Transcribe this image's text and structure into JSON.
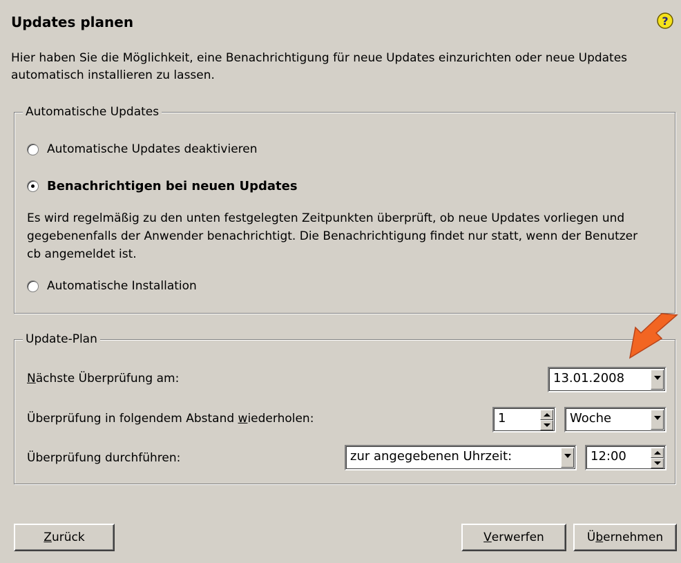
{
  "header": {
    "title": "Updates planen",
    "help_icon": "help-question-icon"
  },
  "intro_text": "Hier haben Sie die Möglichkeit, eine Benachrichtigung für neue Updates einzurichten oder neue Updates automatisch installieren zu lassen.",
  "auto_updates": {
    "legend": "Automatische Updates",
    "options": [
      {
        "label": "Automatische Updates deaktivieren",
        "selected": false
      },
      {
        "label": "Benachrichtigen bei neuen Updates",
        "selected": true
      },
      {
        "label": "Automatische Installation",
        "selected": false
      }
    ],
    "description": "Es wird regelmäßig zu den unten festgelegten Zeitpunkten überprüft, ob neue Updates vorliegen und gegebenenfalls der Anwender benachrichtigt. Die Benachrichtigung findet nur statt, wenn der Benutzer cb angemeldet ist."
  },
  "update_plan": {
    "legend": "Update-Plan",
    "next_check": {
      "label_accel": "N",
      "label_rest": "ächste Überprüfung am:",
      "value": "13.01.2008"
    },
    "repeat": {
      "label_pre": "Überprüfung in folgendem Abstand ",
      "label_accel": "w",
      "label_post": "iederholen:",
      "interval": "1",
      "unit": "Woche"
    },
    "perform": {
      "label": "Überprüfung durchführen:",
      "mode": "zur angegebenen Uhrzeit:",
      "time": "12:00"
    }
  },
  "buttons": {
    "back": {
      "accel": "Z",
      "rest": "urück"
    },
    "discard": {
      "accel": "V",
      "rest": "erwerfen"
    },
    "apply": {
      "pre": "Ü",
      "accel": "b",
      "rest": "ernehmen"
    }
  },
  "colors": {
    "background": "#d4d0c8",
    "arrow": "#f26522",
    "help_icon": "#f5e21a"
  }
}
